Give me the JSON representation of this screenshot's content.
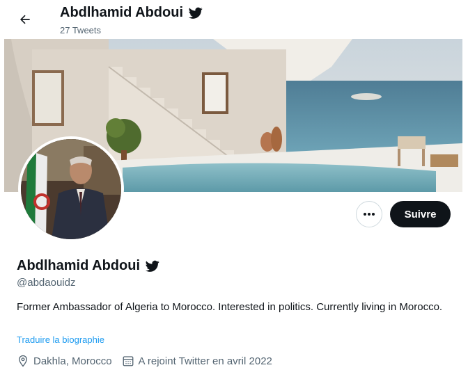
{
  "header": {
    "name": "Abdlhamid Abdoui",
    "tweet_count": "27 Tweets"
  },
  "profile": {
    "name": "Abdlhamid Abdoui",
    "handle": "@abdaouidz",
    "bio": "Former Ambassador of Algeria to Morocco. Interested in politics. Currently living in Morocco.",
    "translate_label": "Traduire la biographie",
    "location": "Dakhla, Morocco",
    "joined": "A rejoint Twitter en avril 2022"
  },
  "actions": {
    "follow_label": "Suivre",
    "more_label": "•••"
  },
  "colors": {
    "text": "#0f1419",
    "secondary": "#536471",
    "link": "#1d9bf0",
    "button_dark": "#0f1419"
  },
  "icons": [
    "back-arrow-icon",
    "bird-icon",
    "more-icon",
    "location-pin-icon",
    "calendar-icon"
  ]
}
